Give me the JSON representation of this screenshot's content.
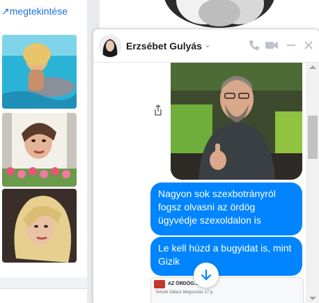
{
  "feed": {
    "link_text": "megtekintése"
  },
  "chat": {
    "contact_name": "Erzsébet Gulyás",
    "header_icons": [
      "phone-icon",
      "video-icon",
      "minimize-icon",
      "close-icon"
    ],
    "messages": [
      "Nagyon sok szexbotrányról fogsz olvasni az ördög ügyvédje szexoldalon is",
      "Le kell húzd a bugyidat is, mint Gizik"
    ],
    "link_preview": {
      "title": "AZ ÖRDÖG...",
      "meta": "Tetszik   Válasz   Megosztás   17 p."
    }
  },
  "colors": {
    "accent": "#0084ff",
    "link": "#216fdb",
    "background": "#e9ebee"
  }
}
